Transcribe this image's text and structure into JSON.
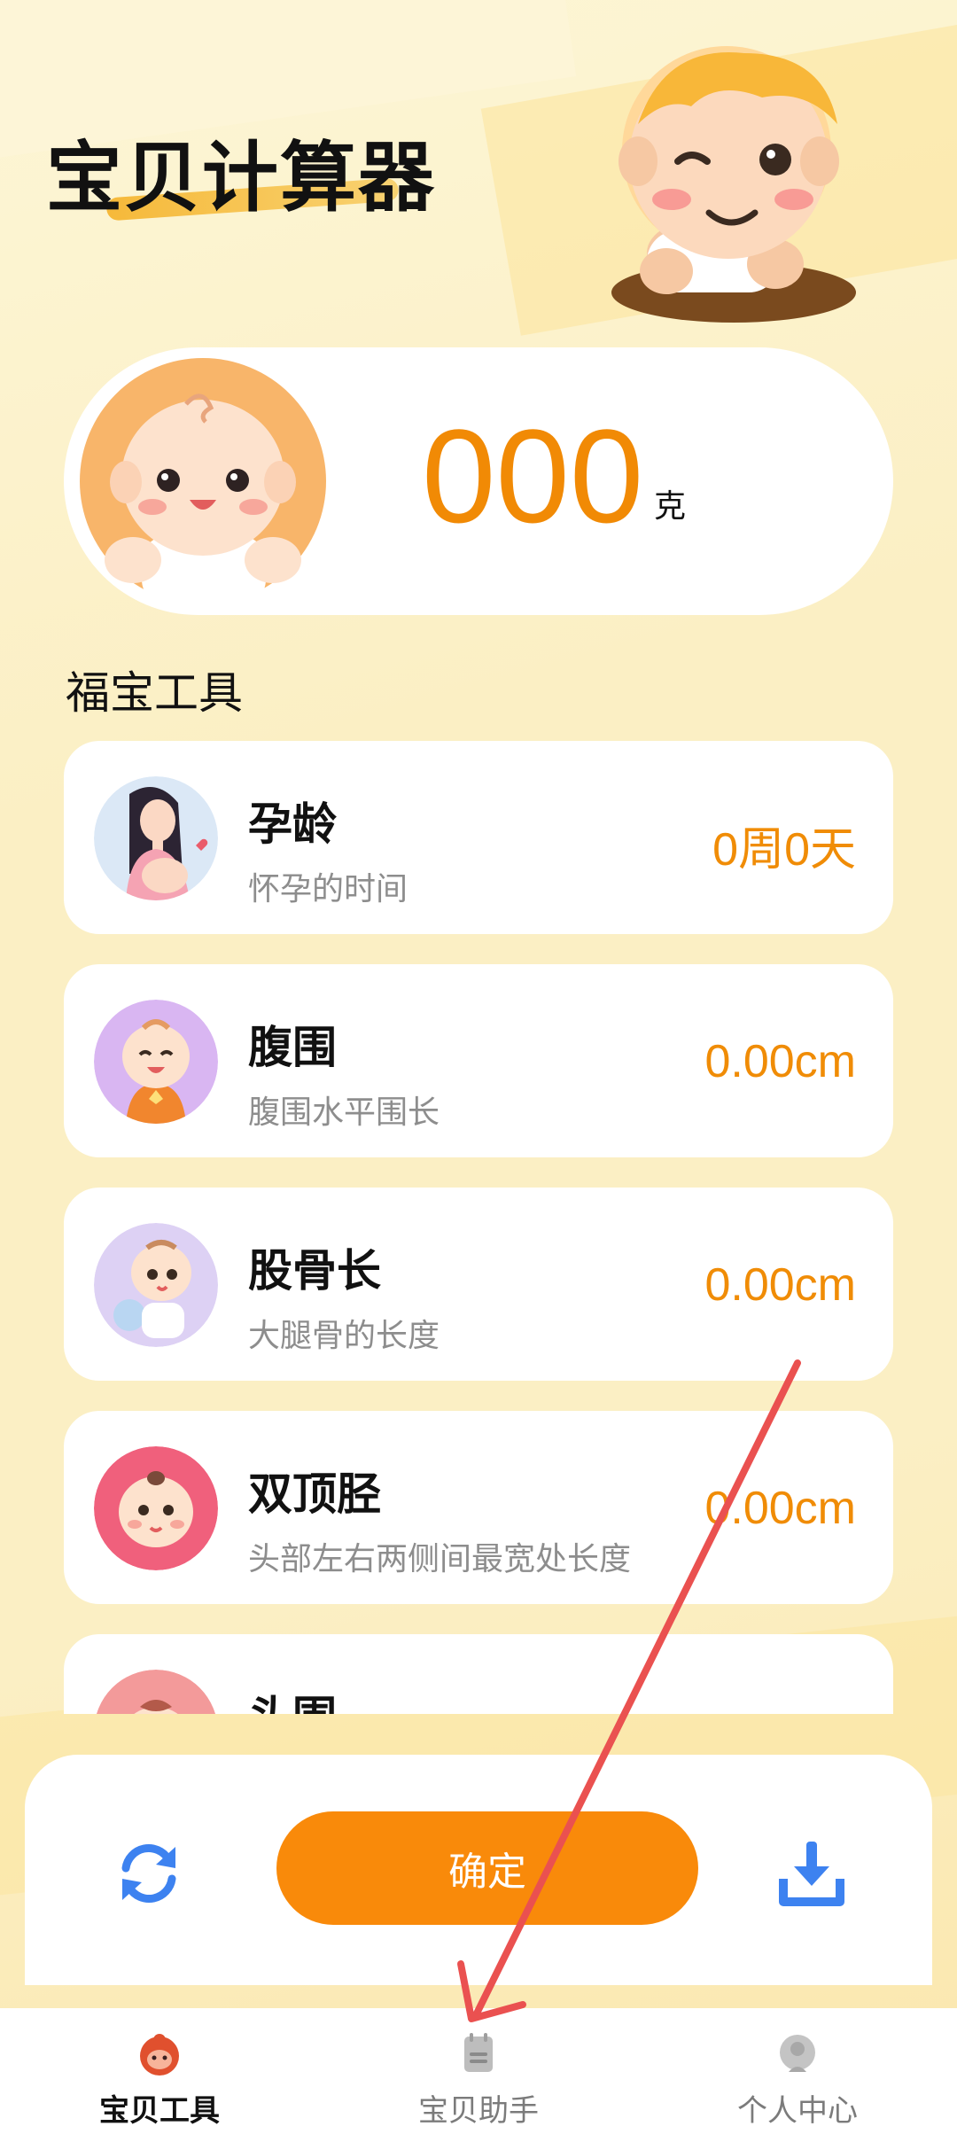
{
  "app": {
    "title": "宝贝计算器"
  },
  "weight": {
    "value": "000",
    "unit": "克"
  },
  "section": {
    "title": "福宝工具"
  },
  "tools": [
    {
      "name": "孕龄",
      "desc": "怀孕的时间",
      "value": "0周0天",
      "icon": "pregnant-woman-icon"
    },
    {
      "name": "腹围",
      "desc": "腹围水平围长",
      "value": "0.00cm",
      "icon": "baby-smile-icon"
    },
    {
      "name": "股骨长",
      "desc": "大腿骨的长度",
      "value": "0.00cm",
      "icon": "baby-ball-icon"
    },
    {
      "name": "双顶胫",
      "desc": "头部左右两侧间最宽处长度",
      "value": "0.00cm",
      "icon": "baby-head-icon"
    },
    {
      "name": "头围",
      "desc": "",
      "value": "",
      "icon": "baby-partial-icon"
    }
  ],
  "actions": {
    "confirm_label": "确定",
    "refresh_icon": "refresh-icon",
    "download_icon": "download-icon"
  },
  "tabbar": {
    "items": [
      {
        "label": "宝贝工具",
        "icon": "baby-face-icon",
        "active": true
      },
      {
        "label": "宝贝助手",
        "icon": "notebook-icon",
        "active": false
      },
      {
        "label": "个人中心",
        "icon": "person-icon",
        "active": false
      }
    ]
  },
  "colors": {
    "accent": "#f98a0a",
    "value_text": "#f08c06",
    "annotation": "#ea5150",
    "refresh_blue": "#3d82f0"
  }
}
